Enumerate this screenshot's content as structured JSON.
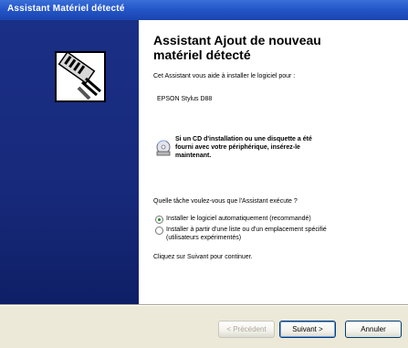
{
  "window": {
    "title": "Assistant Matériel détecté"
  },
  "wizard": {
    "heading_line1": "Assistant Ajout de nouveau",
    "heading_line2": "matériel détecté",
    "intro": "Cet Assistant vous aide à installer le logiciel pour :",
    "device_name": "EPSON Stylus D88",
    "cd_hint_line1": "Si un CD d'installation ou une disquette a été",
    "cd_hint_line2": "fourni avec votre périphérique, insérez-le",
    "cd_hint_line3": "maintenant.",
    "question": "Quelle tâche voulez-vous que l'Assistant exécute ?",
    "options": [
      {
        "label": "Installer le logiciel automatiquement (recommandé)",
        "selected": true
      },
      {
        "label_line1": "Installer à partir d'une liste ou d'un emplacement spécifié",
        "label_line2": "(utilisateurs expérimentés)",
        "selected": false
      }
    ],
    "continue_hint": "Cliquez sur Suivant pour continuer."
  },
  "buttons": {
    "back": "< Précédent",
    "next": "Suivant >",
    "cancel": "Annuler"
  },
  "icons": {
    "hardware": "hardware-wizard-icon",
    "cd": "cd-disk-icon"
  },
  "colors": {
    "sidebar": "#17297a",
    "titlebar": "#2456c8",
    "radio_selected": "#2a8a2a"
  }
}
